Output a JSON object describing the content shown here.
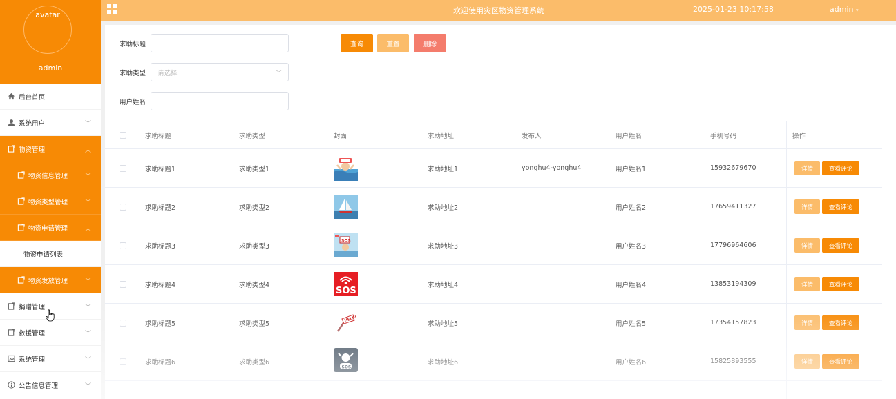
{
  "sidebar": {
    "avatar_text": "avatar",
    "username": "admin",
    "items": [
      {
        "label": "后台首页",
        "icon": "home-icon"
      },
      {
        "label": "系统用户",
        "icon": "user-icon"
      },
      {
        "label": "物资管理",
        "icon": "doc-icon"
      },
      {
        "label": "物资信息管理",
        "icon": "doc-icon"
      },
      {
        "label": "物资类型管理",
        "icon": "doc-icon"
      },
      {
        "label": "物资申请管理",
        "icon": "doc-icon"
      },
      {
        "label": "物资申请列表"
      },
      {
        "label": "物资发放管理",
        "icon": "doc-icon"
      },
      {
        "label": "捐赠管理",
        "icon": "doc-icon"
      },
      {
        "label": "救援管理",
        "icon": "doc-icon"
      },
      {
        "label": "系统管理",
        "icon": "image-icon"
      },
      {
        "label": "公告信息管理",
        "icon": "info-icon"
      }
    ]
  },
  "topbar": {
    "title": "欢迎使用灾区物资管理系统",
    "datetime": "2025-01-23 10:17:58",
    "user": "admin"
  },
  "filters": {
    "title_label": "求助标题",
    "type_label": "求助类型",
    "type_placeholder": "请选择",
    "username_label": "用户姓名",
    "search": "查询",
    "reset": "重置",
    "delete": "删除"
  },
  "table": {
    "headers": [
      "求助标题",
      "求助类型",
      "封面",
      "求助地址",
      "发布人",
      "用户姓名",
      "手机号码",
      "操作"
    ],
    "detail_label": "详情",
    "comment_label": "查看评论",
    "rows": [
      {
        "title": "求助标题1",
        "type": "求助类型1",
        "address": "求助地址1",
        "publisher": "yonghu4-yonghu4",
        "name": "用户姓名1",
        "phone": "15932679670"
      },
      {
        "title": "求助标题2",
        "type": "求助类型2",
        "address": "求助地址2",
        "publisher": "",
        "name": "用户姓名2",
        "phone": "17659411327"
      },
      {
        "title": "求助标题3",
        "type": "求助类型3",
        "address": "求助地址3",
        "publisher": "",
        "name": "用户姓名3",
        "phone": "17796964606"
      },
      {
        "title": "求助标题4",
        "type": "求助类型4",
        "address": "求助地址4",
        "publisher": "",
        "name": "用户姓名4",
        "phone": "13853194309"
      },
      {
        "title": "求助标题5",
        "type": "求助类型5",
        "address": "求助地址5",
        "publisher": "",
        "name": "用户姓名5",
        "phone": "17354157823"
      },
      {
        "title": "求助标题6",
        "type": "求助类型6",
        "address": "求助地址6",
        "publisher": "",
        "name": "用户姓名6",
        "phone": "15825893555"
      }
    ]
  },
  "colors": {
    "primary": "#f78a05",
    "light": "#fbbc6a",
    "danger": "#f47c6c"
  }
}
